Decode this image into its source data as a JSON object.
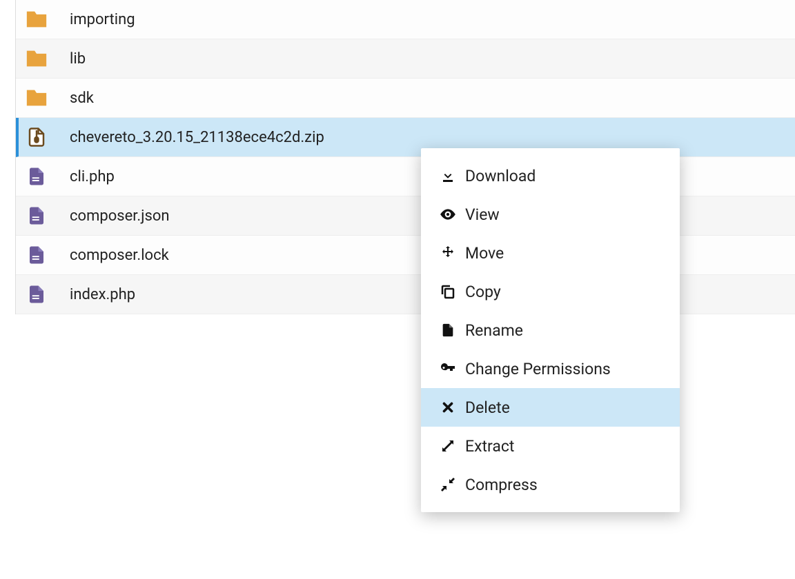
{
  "files": [
    {
      "name": "importing",
      "type": "folder"
    },
    {
      "name": "lib",
      "type": "folder"
    },
    {
      "name": "sdk",
      "type": "folder"
    },
    {
      "name": "chevereto_3.20.15_21138ece4c2d.zip",
      "type": "zip",
      "selected": true
    },
    {
      "name": "cli.php",
      "type": "file"
    },
    {
      "name": "composer.json",
      "type": "file"
    },
    {
      "name": "composer.lock",
      "type": "file"
    },
    {
      "name": "index.php",
      "type": "file"
    }
  ],
  "contextMenu": {
    "download": "Download",
    "view": "View",
    "move": "Move",
    "copy": "Copy",
    "rename": "Rename",
    "changePermissions": "Change Permissions",
    "delete": "Delete",
    "extract": "Extract",
    "compress": "Compress"
  }
}
